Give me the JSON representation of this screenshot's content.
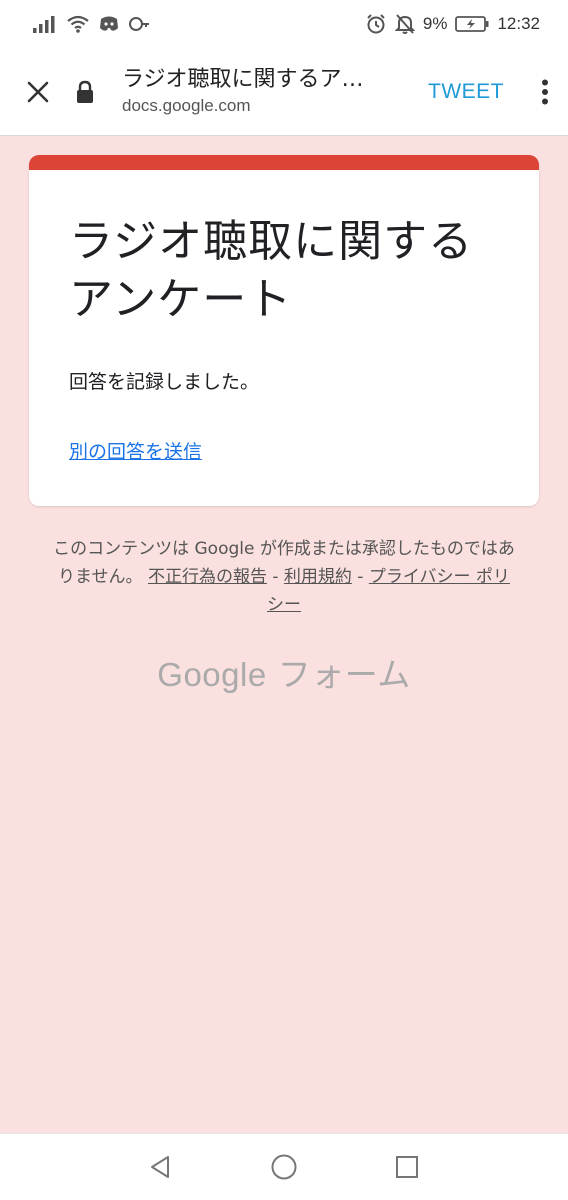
{
  "status_bar": {
    "battery": "9%",
    "time": "12:32"
  },
  "app_bar": {
    "title": "ラジオ聴取に関するア…",
    "url": "docs.google.com",
    "action_label": "TWEET"
  },
  "form": {
    "title": "ラジオ聴取に関するアンケート",
    "confirmation": "回答を記録しました。",
    "another_response_link": "別の回答を送信",
    "accent_color": "#db4437"
  },
  "footer": {
    "disclaimer_text": "このコンテンツは Google が作成または承認したものではありません。",
    "abuse_link": "不正行為の報告",
    "separator": " - ",
    "terms_link": "利用規約",
    "privacy_link": "プライバシー ポリシー",
    "brand_google": "Google",
    "brand_forms": "フォーム"
  },
  "icons": {
    "status_left": [
      "signal-icon",
      "wifi-icon",
      "discord-icon",
      "key-icon"
    ],
    "status_right": [
      "alarm-icon",
      "mute-bell-icon",
      "battery-icon"
    ],
    "app_bar": [
      "close-icon",
      "lock-icon",
      "more-vert-icon"
    ],
    "nav": [
      "back-icon",
      "home-icon",
      "recents-icon"
    ]
  },
  "colors": {
    "background": "#fae0df",
    "link": "#1a73e8",
    "tweet": "#1e9ad6"
  }
}
